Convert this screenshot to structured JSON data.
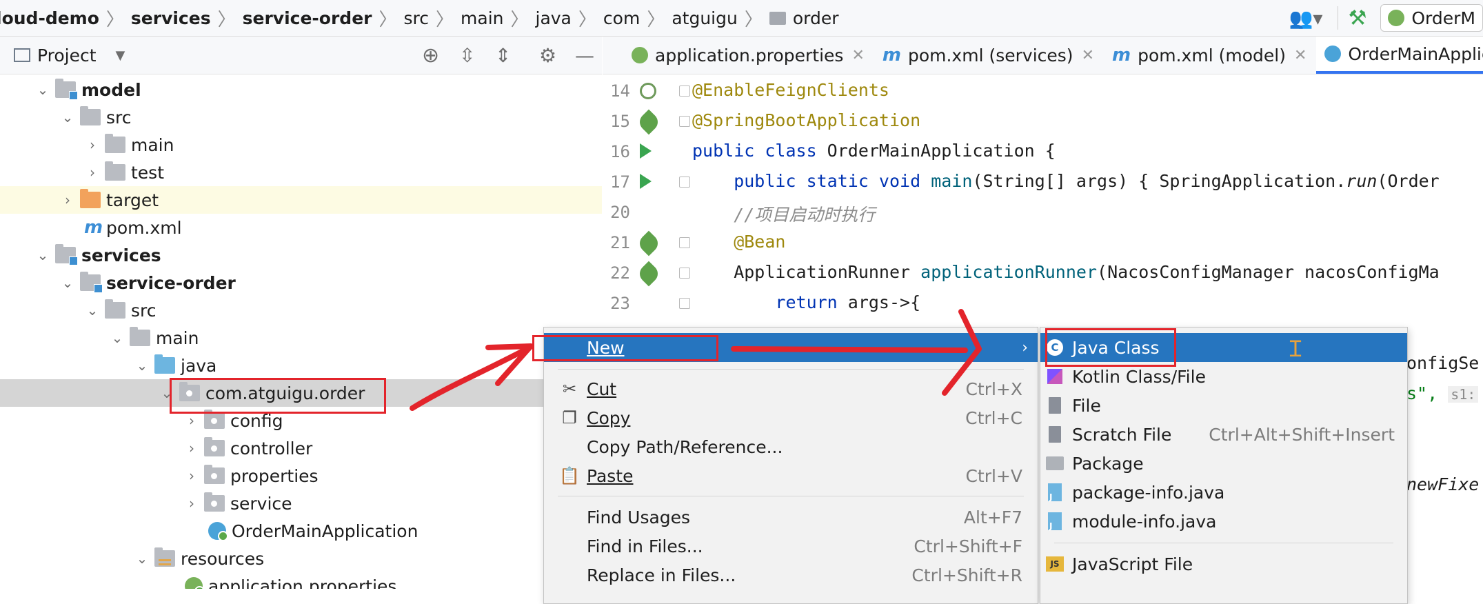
{
  "breadcrumb": {
    "items": [
      "loud-demo",
      "services",
      "service-order",
      "src",
      "main",
      "java",
      "com",
      "atguigu",
      "order"
    ]
  },
  "toolbar": {
    "run_config_label": "OrderM"
  },
  "project_panel": {
    "title": "Project",
    "tree": [
      {
        "label": "model",
        "bold": true
      },
      {
        "label": "src"
      },
      {
        "label": "main"
      },
      {
        "label": "test"
      },
      {
        "label": "target"
      },
      {
        "label": "pom.xml"
      },
      {
        "label": "services",
        "bold": true
      },
      {
        "label": "service-order",
        "bold": true
      },
      {
        "label": "src"
      },
      {
        "label": "main"
      },
      {
        "label": "java"
      },
      {
        "label": "com.atguigu.order",
        "selected": true
      },
      {
        "label": "config"
      },
      {
        "label": "controller"
      },
      {
        "label": "properties"
      },
      {
        "label": "service"
      },
      {
        "label": "OrderMainApplication"
      },
      {
        "label": "resources"
      },
      {
        "label": "application.properties"
      }
    ]
  },
  "editor": {
    "tabs": [
      {
        "label": "application.properties"
      },
      {
        "label": "pom.xml (services)"
      },
      {
        "label": "pom.xml (model)"
      },
      {
        "label": "OrderMainApplicatio",
        "active": true
      }
    ],
    "line_numbers": [
      "14",
      "15",
      "16",
      "17",
      "20",
      "21",
      "22",
      "23"
    ],
    "lines": {
      "l14": "@EnableFeignClients",
      "l15": "@SpringBootApplication",
      "l16_kw": "public class",
      "l16_rest": " OrderMainApplication {",
      "l17_kw": "    public static void",
      "l17_fn": " main",
      "l17_rest": "(String[] args) { SpringApplication.",
      "l17_run": "run",
      "l17_tail": "(Order",
      "l20": "    //项目启动时执行",
      "l21": "    @Bean",
      "l22_a": "    ApplicationRunner ",
      "l22_fn": "applicationRunner",
      "l22_rest": "(NacosConfigManager nacosConfigMa",
      "l23_kw": "        return",
      "l23_rest": " args->{",
      "frag_a": "onfigSe",
      "frag_b": "s\",",
      "frag_hint": "s1:",
      "frag_c": "newFixe"
    }
  },
  "context_menu": {
    "items": [
      {
        "label": "New",
        "mnemonic_index": 0,
        "selected": true,
        "submenu": true
      },
      {
        "label": "Cut",
        "shortcut": "Ctrl+X",
        "icon": "scissors-icon"
      },
      {
        "label": "Copy",
        "shortcut": "Ctrl+C",
        "icon": "copy-icon"
      },
      {
        "label": "Copy Path/Reference..."
      },
      {
        "label": "Paste",
        "shortcut": "Ctrl+V",
        "icon": "clipboard-icon"
      },
      {
        "label": "Find Usages",
        "shortcut": "Alt+F7"
      },
      {
        "label": "Find in Files...",
        "shortcut": "Ctrl+Shift+F"
      },
      {
        "label": "Replace in Files...",
        "shortcut": "Ctrl+Shift+R"
      }
    ]
  },
  "new_submenu": {
    "items": [
      {
        "label": "Java Class",
        "selected": true,
        "icon": "java-class-icon"
      },
      {
        "label": "Kotlin Class/File",
        "icon": "kotlin-icon"
      },
      {
        "label": "File",
        "icon": "file-icon"
      },
      {
        "label": "Scratch File",
        "shortcut": "Ctrl+Alt+Shift+Insert",
        "icon": "scratch-file-icon"
      },
      {
        "label": "Package",
        "icon": "package-icon"
      },
      {
        "label": "package-info.java",
        "icon": "java-file-icon"
      },
      {
        "label": "module-info.java",
        "icon": "java-file-icon"
      },
      {
        "label": "JavaScript File",
        "icon": "javascript-icon"
      }
    ]
  },
  "colors": {
    "selection": "#2675bf",
    "annotation_box": "#e3242b",
    "arrow": "#e3242b"
  }
}
